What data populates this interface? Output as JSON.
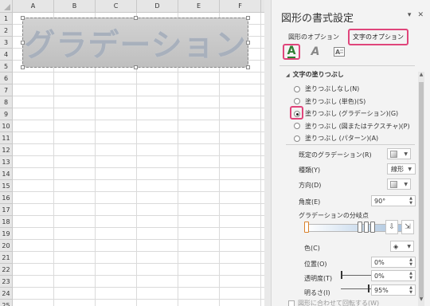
{
  "sheet": {
    "columns": [
      "A",
      "B",
      "C",
      "D",
      "E",
      "F",
      ""
    ],
    "rows": [
      "1",
      "2",
      "3",
      "4",
      "5",
      "6",
      "7",
      "8",
      "9",
      "10",
      "11",
      "12",
      "13",
      "14",
      "15",
      "16",
      "17",
      "18",
      "19",
      "20",
      "21",
      "22",
      "23",
      "24",
      "25"
    ],
    "shape_text": "グラデーション"
  },
  "pane": {
    "title": "図形の書式設定",
    "dropdown_icon": "chevron-down-icon",
    "close_icon": "close-icon",
    "tabs": [
      {
        "label": "図形のオプション",
        "active": false
      },
      {
        "label": "文字のオプション",
        "active": true
      }
    ],
    "section_title": "文字の塗りつぶし",
    "fill_options": [
      {
        "label": "塗りつぶしなし(N)",
        "checked": false
      },
      {
        "label": "塗りつぶし (単色)(S)",
        "checked": false
      },
      {
        "label": "塗りつぶし (グラデーション)(G)",
        "checked": true
      },
      {
        "label": "塗りつぶし (図またはテクスチャ)(P)",
        "checked": false
      },
      {
        "label": "塗りつぶし (パターン)(A)",
        "checked": false
      }
    ],
    "preset_label": "既定のグラデーション(R)",
    "type_label": "種類(Y)",
    "type_value": "線形",
    "direction_label": "方向(D)",
    "angle_label": "角度(E)",
    "angle_value": "90°",
    "stops_label": "グラデーションの分岐点",
    "color_label": "色(C)",
    "position_label": "位置(O)",
    "position_value": "0%",
    "transparency_label": "透明度(T)",
    "transparency_value": "0%",
    "brightness_label": "明るさ(I)",
    "brightness_value": "95%",
    "brightness_level": 0.95,
    "rotate_label": "図形に合わせて回転する(W)",
    "accent_color": "#e0457b",
    "excel_green": "#217346"
  }
}
